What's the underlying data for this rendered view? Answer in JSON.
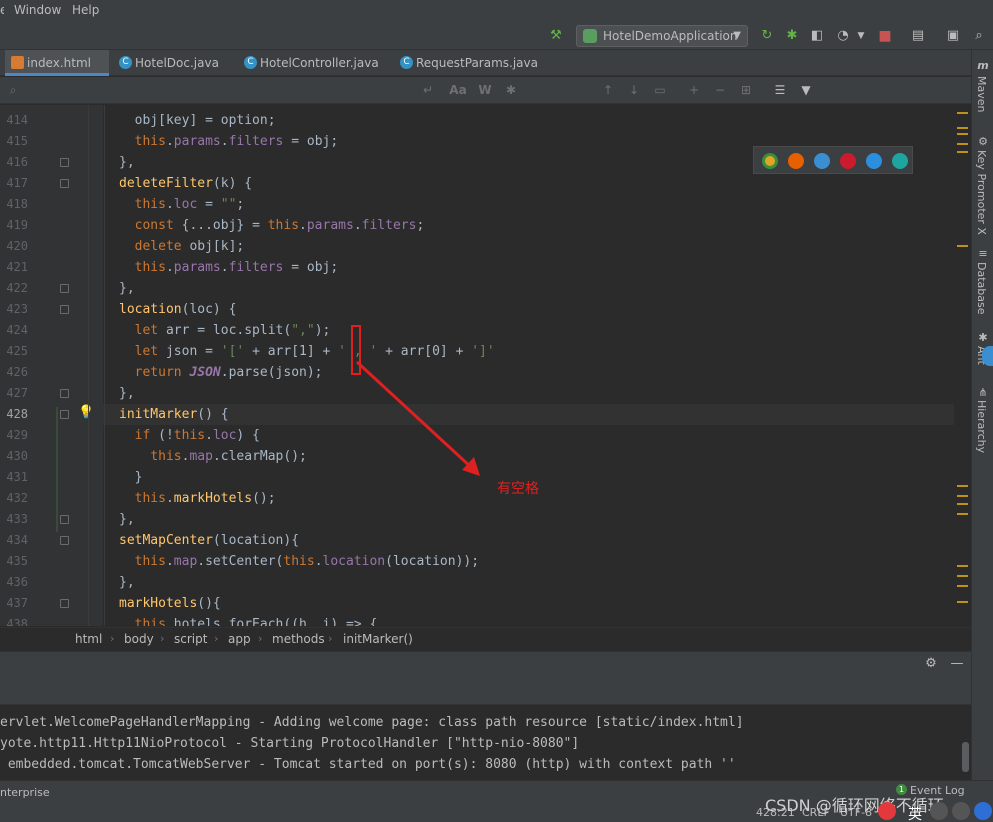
{
  "menubar": {
    "items": [
      "Window",
      "Help"
    ]
  },
  "toolbar": {
    "run_config": "HotelDemoApplication"
  },
  "tabs": [
    {
      "label": "index.html",
      "icon": "html-file-icon",
      "active": true
    },
    {
      "label": "HotelDoc.java",
      "icon": "java-class-icon"
    },
    {
      "label": "HotelController.java",
      "icon": "java-class-icon"
    },
    {
      "label": "RequestParams.java",
      "icon": "java-class-icon"
    }
  ],
  "tab_close_glyph": "×",
  "search_icons": [
    "Aa",
    "W"
  ],
  "editor": {
    "current_line": "428",
    "lines": [
      {
        "num": "414",
        "text": "  obj[key] = option;"
      },
      {
        "num": "415",
        "text": "  this.params.filters = obj;"
      },
      {
        "num": "416",
        "text": "},"
      },
      {
        "num": "417",
        "text": "deleteFilter(k) {"
      },
      {
        "num": "418",
        "text": "  this.loc = \"\";"
      },
      {
        "num": "419",
        "text": "  const {...obj} = this.params.filters;"
      },
      {
        "num": "420",
        "text": "  delete obj[k];"
      },
      {
        "num": "421",
        "text": "  this.params.filters = obj;"
      },
      {
        "num": "422",
        "text": "},"
      },
      {
        "num": "423",
        "text": "location(loc) {"
      },
      {
        "num": "424",
        "text": "  let arr = loc.split(\",\");"
      },
      {
        "num": "425",
        "text": "  let json = '[' + arr[1] + ' , ' + arr[0] + ']'"
      },
      {
        "num": "426",
        "text": "  return JSON.parse(json);"
      },
      {
        "num": "427",
        "text": "},"
      },
      {
        "num": "428",
        "text": "initMarker() {"
      },
      {
        "num": "429",
        "text": "  if (!this.loc) {"
      },
      {
        "num": "430",
        "text": "    this.map.clearMap();"
      },
      {
        "num": "431",
        "text": "  }"
      },
      {
        "num": "432",
        "text": "  this.markHotels();"
      },
      {
        "num": "433",
        "text": "},"
      },
      {
        "num": "434",
        "text": "setMapCenter(location){"
      },
      {
        "num": "435",
        "text": "  this.map.setCenter(this.location(location));"
      },
      {
        "num": "436",
        "text": "},"
      },
      {
        "num": "437",
        "text": "markHotels(){"
      },
      {
        "num": "438",
        "text": "  this.hotels.forEach((h, i) => {"
      }
    ]
  },
  "browsers": [
    "chrome-icon",
    "firefox-icon",
    "safari-icon",
    "opera-icon",
    "ie-icon",
    "edge-icon"
  ],
  "annotation": {
    "text": "有空格"
  },
  "breadcrumb": [
    "html",
    "body",
    "script",
    "app",
    "methods",
    "initMarker()"
  ],
  "console": {
    "lines": [
      "ervlet.WelcomePageHandlerMapping - Adding welcome page: class path resource [static/index.html]",
      "yote.http11.Http11NioProtocol - Starting ProtocolHandler [\"http-nio-8080\"]",
      " embedded.tomcat.TomcatWebServer - Tomcat started on port(s): 8080 (http) with context path ''"
    ]
  },
  "status": {
    "left": "nterprise",
    "position": "428:21",
    "line_sep": "CRLF",
    "encoding": "UTF-8",
    "event_log": "Event Log",
    "event_count": "1"
  },
  "right_strip": [
    "Maven",
    "Key Promoter X",
    "Database",
    "Ant",
    "Hierarchy"
  ],
  "watermark": "CSDN @循环网络不循环",
  "ime_label": "英"
}
